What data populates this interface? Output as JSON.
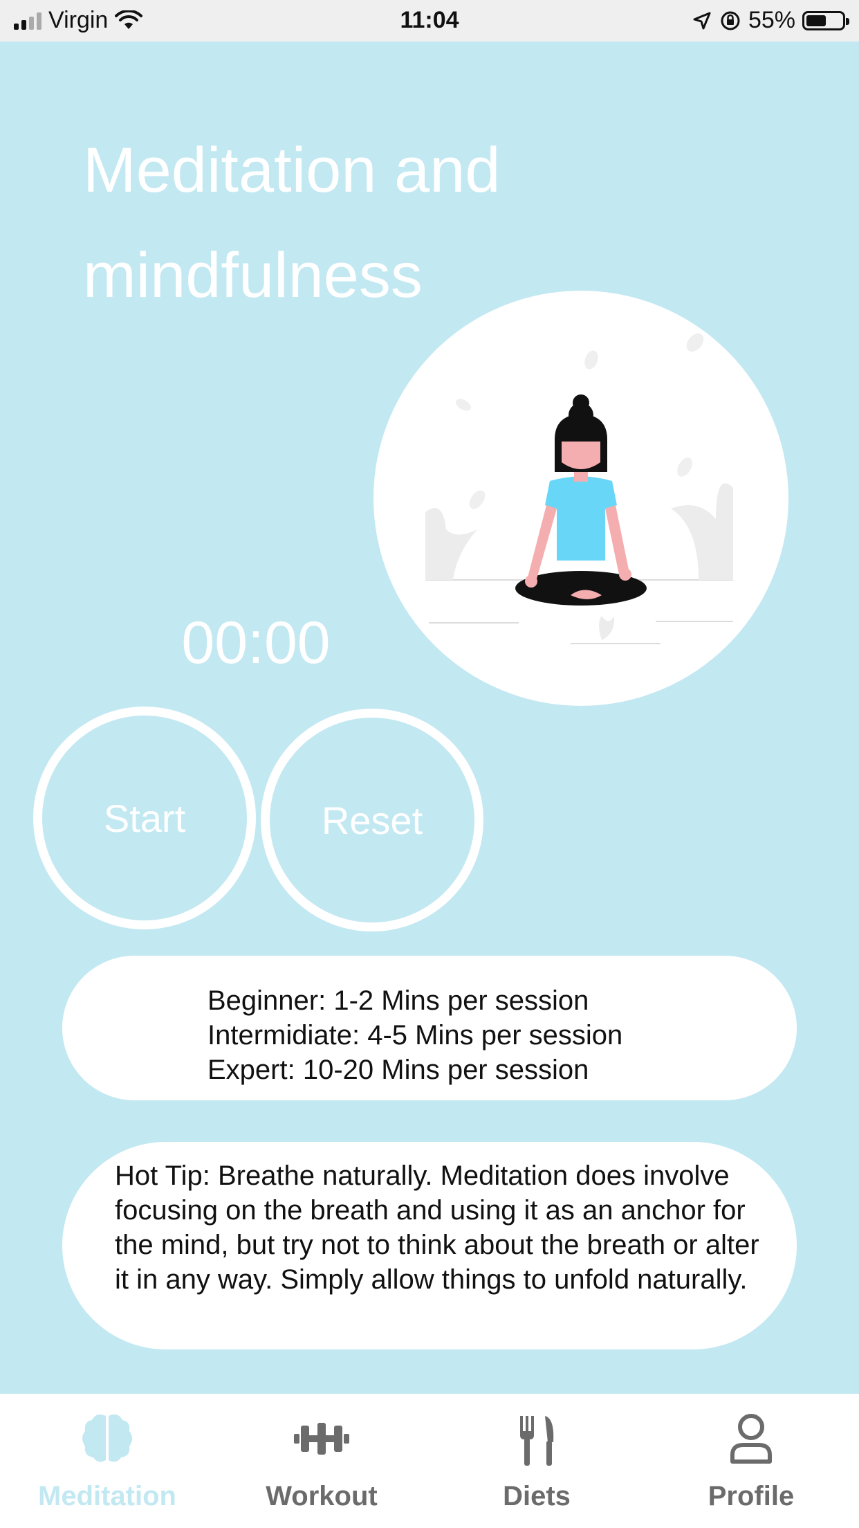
{
  "status_bar": {
    "carrier": "Virgin",
    "time": "11:04",
    "battery": "55%",
    "battery_level": 0.55
  },
  "page": {
    "title_line1": "Meditation and",
    "title_line2": "mindfulness"
  },
  "timer": {
    "display": "00:00",
    "start_label": "Start",
    "reset_label": "Reset"
  },
  "levels": [
    "Beginner: 1-2 Mins per session",
    "Intermidiate: 4-5 Mins per session",
    "Expert: 10-20 Mins per session"
  ],
  "tip": {
    "text": "Hot Tip: Breathe naturally. Meditation does involve focusing on the breath and using it as an anchor for the mind, but try not to think about the breath or alter it in any way. Simply allow things to unfold naturally."
  },
  "tabs": [
    {
      "label": "Meditation",
      "icon": "brain-icon",
      "active": true
    },
    {
      "label": "Workout",
      "icon": "dumbbell-icon",
      "active": false
    },
    {
      "label": "Diets",
      "icon": "fork-knife-icon",
      "active": false
    },
    {
      "label": "Profile",
      "icon": "person-icon",
      "active": false
    }
  ],
  "colors": {
    "background": "#c2e8f2",
    "active_tab": "#c2e8f2",
    "inactive_tab": "#6b6b6b",
    "shirt": "#68d6f7"
  }
}
